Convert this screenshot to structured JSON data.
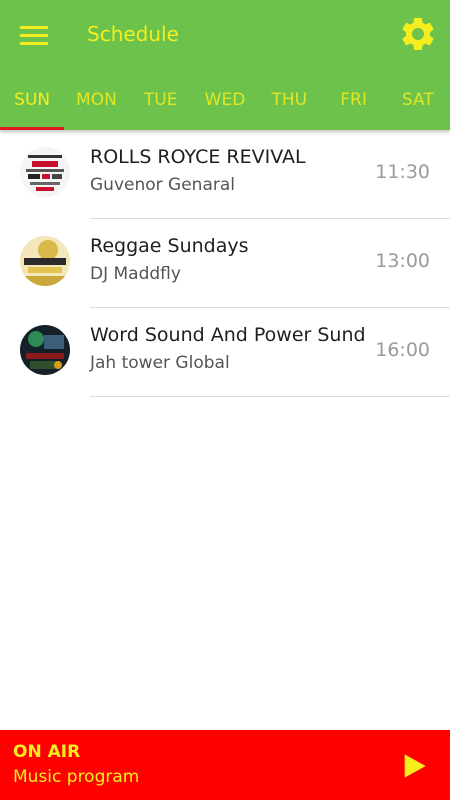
{
  "header": {
    "title": "Schedule",
    "menu_icon": "menu-icon",
    "settings_icon": "gear-icon"
  },
  "tabs": [
    {
      "label": "SUN",
      "active": true
    },
    {
      "label": "MON",
      "active": false
    },
    {
      "label": "TUE",
      "active": false
    },
    {
      "label": "WED",
      "active": false
    },
    {
      "label": "THU",
      "active": false
    },
    {
      "label": "FRI",
      "active": false
    },
    {
      "label": "SAT",
      "active": false
    }
  ],
  "schedule": [
    {
      "title": "ROLLS ROYCE REVIVAL",
      "host": "Guvenor Genaral",
      "time": "11:30"
    },
    {
      "title": "Reggae Sundays",
      "host": "DJ Maddfly",
      "time": "13:00"
    },
    {
      "title": "Word Sound And Power Sund",
      "host": "Jah tower Global",
      "time": "16:00"
    }
  ],
  "player": {
    "status": "ON AIR",
    "program": "Music program",
    "play_icon": "play-icon"
  },
  "colors": {
    "appbar": "#6cc24a",
    "accent_text": "#f4ee1f",
    "tab_indicator": "#e11b1b",
    "player_bg": "#ff0000"
  }
}
